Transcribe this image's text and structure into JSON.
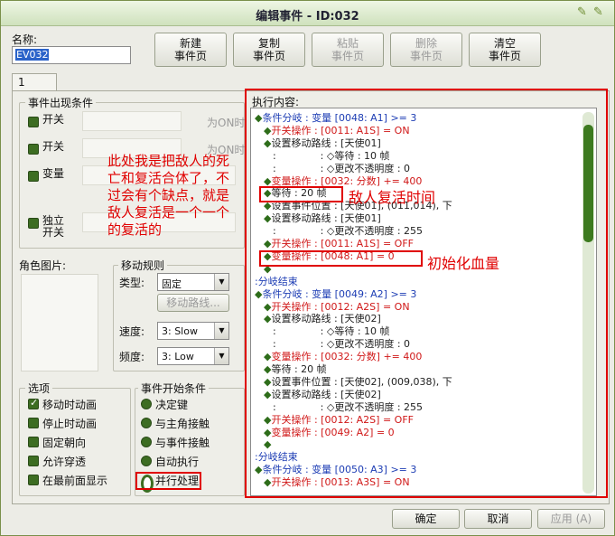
{
  "window": {
    "title": "编辑事件 - ID:032"
  },
  "name_field": {
    "label": "名称:",
    "value": "EV032"
  },
  "toolbar": [
    {
      "label1": "新建",
      "label2": "事件页",
      "enabled": true
    },
    {
      "label1": "复制",
      "label2": "事件页",
      "enabled": true
    },
    {
      "label1": "粘贴",
      "label2": "事件页",
      "enabled": false
    },
    {
      "label1": "删除",
      "label2": "事件页",
      "enabled": false
    },
    {
      "label1": "清空",
      "label2": "事件页",
      "enabled": true
    }
  ],
  "tab": {
    "label": "1"
  },
  "conditions": {
    "title": "事件出现条件",
    "items": [
      {
        "label": "开关",
        "extra": "为ON时"
      },
      {
        "label": "开关",
        "extra": "为ON时"
      },
      {
        "label": "变量",
        "extra": ""
      },
      {
        "label": "独立\n开关",
        "extra": ""
      }
    ]
  },
  "annotation_main": "此处我是把敌人的死亡和复活合体了，不过会有个缺点，就是敌人复活是一个一个的复活的",
  "character_image": {
    "label": "角色图片:"
  },
  "move": {
    "title": "移动规则",
    "type_label": "类型:",
    "type_value": "固定",
    "route_button": "移动路线...",
    "speed_label": "速度:",
    "speed_value": "3: Slow",
    "freq_label": "频度:",
    "freq_value": "3: Low"
  },
  "options": {
    "title": "选项",
    "items": [
      {
        "label": "移动时动画",
        "checked": true
      },
      {
        "label": "停止时动画",
        "checked": false
      },
      {
        "label": "固定朝向",
        "checked": false
      },
      {
        "label": "允许穿透",
        "checked": false
      },
      {
        "label": "在最前面显示",
        "checked": false
      }
    ]
  },
  "trigger": {
    "title": "事件开始条件",
    "items": [
      {
        "label": "决定键",
        "selected": false
      },
      {
        "label": "与主角接触",
        "selected": false
      },
      {
        "label": "与事件接触",
        "selected": false
      },
      {
        "label": "自动执行",
        "selected": false
      },
      {
        "label": "并行处理",
        "selected": true
      }
    ]
  },
  "content": {
    "label": "执行内容:",
    "lines": [
      {
        "d": "◆",
        "t": "条件分岐 : 变量 [0048: A1] >= 3",
        "c": "blue",
        "i": 0
      },
      {
        "d": "◆",
        "t": "开关操作 : [0011: A1S] = ON",
        "c": "red",
        "i": 1
      },
      {
        "d": "◆",
        "t": "设置移动路线 : [天使01]",
        "c": "dark",
        "i": 1
      },
      {
        "d": "",
        "t": ":              : ◇等待 : 10 帧",
        "c": "dark",
        "i": 2
      },
      {
        "d": "",
        "t": ":              : ◇更改不透明度 : 0",
        "c": "dark",
        "i": 2
      },
      {
        "d": "◆",
        "t": "变量操作 : [0032: 分数] += 400",
        "c": "red",
        "i": 1
      },
      {
        "d": "◆",
        "t": "等待 : 20 帧",
        "c": "dark",
        "i": 1
      },
      {
        "d": "◆",
        "t": "设置事件位置 : [天使01], (011,014), 下",
        "c": "dark",
        "i": 1
      },
      {
        "d": "◆",
        "t": "设置移动路线 : [天使01]",
        "c": "dark",
        "i": 1
      },
      {
        "d": "",
        "t": ":              : ◇更改不透明度 : 255",
        "c": "dark",
        "i": 2
      },
      {
        "d": "◆",
        "t": "开关操作 : [0011: A1S] = OFF",
        "c": "red",
        "i": 1
      },
      {
        "d": "◆",
        "t": "变量操作 : [0048: A1] = 0",
        "c": "red",
        "i": 1
      },
      {
        "d": "◆",
        "t": "",
        "c": "dark",
        "i": 1
      },
      {
        "d": "",
        "t": ":分岐结束",
        "c": "blue",
        "i": 0
      },
      {
        "d": "◆",
        "t": "条件分岐 : 变量 [0049: A2] >= 3",
        "c": "blue",
        "i": 0
      },
      {
        "d": "◆",
        "t": "开关操作 : [0012: A2S] = ON",
        "c": "red",
        "i": 1
      },
      {
        "d": "◆",
        "t": "设置移动路线 : [天使02]",
        "c": "dark",
        "i": 1
      },
      {
        "d": "",
        "t": ":              : ◇等待 : 10 帧",
        "c": "dark",
        "i": 2
      },
      {
        "d": "",
        "t": ":              : ◇更改不透明度 : 0",
        "c": "dark",
        "i": 2
      },
      {
        "d": "◆",
        "t": "变量操作 : [0032: 分数] += 400",
        "c": "red",
        "i": 1
      },
      {
        "d": "◆",
        "t": "等待 : 20 帧",
        "c": "dark",
        "i": 1
      },
      {
        "d": "◆",
        "t": "设置事件位置 : [天使02], (009,038), 下",
        "c": "dark",
        "i": 1
      },
      {
        "d": "◆",
        "t": "设置移动路线 : [天使02]",
        "c": "dark",
        "i": 1
      },
      {
        "d": "",
        "t": ":              : ◇更改不透明度 : 255",
        "c": "dark",
        "i": 2
      },
      {
        "d": "◆",
        "t": "开关操作 : [0012: A2S] = OFF",
        "c": "red",
        "i": 1
      },
      {
        "d": "◆",
        "t": "变量操作 : [0049: A2] = 0",
        "c": "red",
        "i": 1
      },
      {
        "d": "◆",
        "t": "",
        "c": "dark",
        "i": 1
      },
      {
        "d": "",
        "t": ":分岐结束",
        "c": "blue",
        "i": 0
      },
      {
        "d": "◆",
        "t": "条件分岐 : 变量 [0050: A3] >= 3",
        "c": "blue",
        "i": 0
      },
      {
        "d": "◆",
        "t": "开关操作 : [0013: A3S] = ON",
        "c": "red",
        "i": 1
      }
    ]
  },
  "annotation_revive": "敌人复活时间",
  "annotation_hp": "初始化血量",
  "footer": {
    "ok": "确定",
    "cancel": "取消",
    "apply": "应用 (A)"
  }
}
